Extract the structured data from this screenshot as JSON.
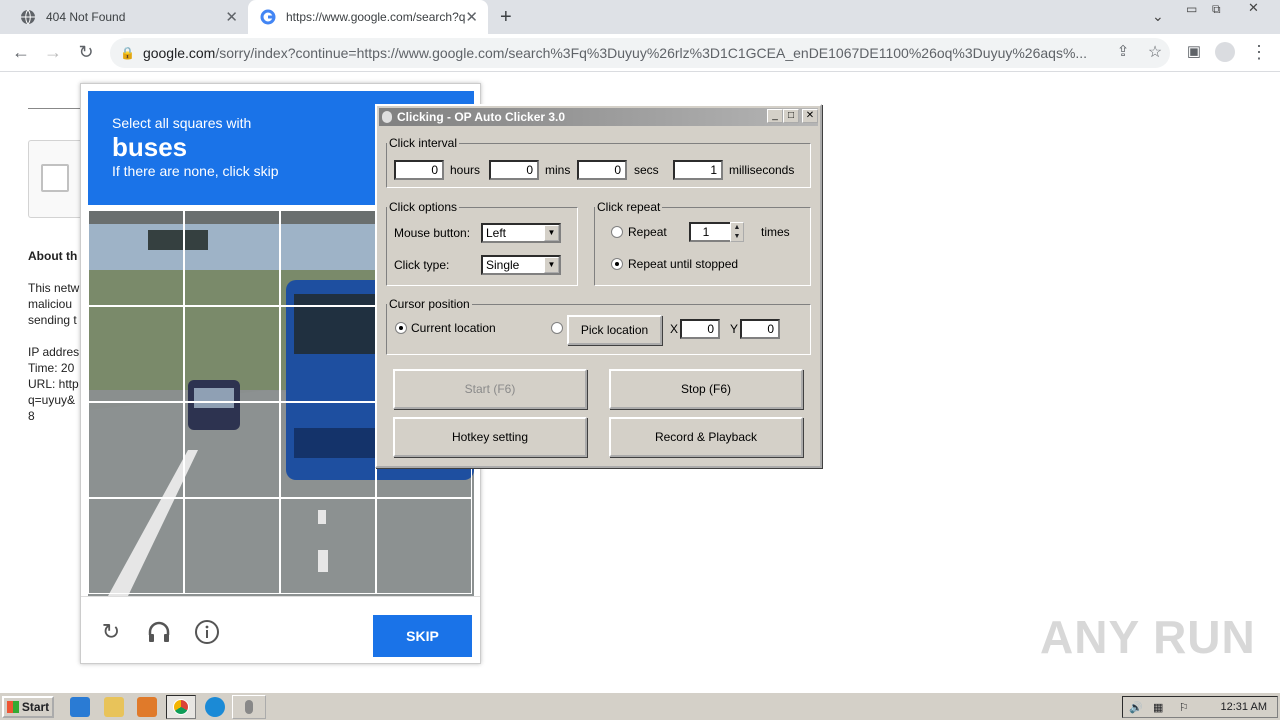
{
  "browser": {
    "tabs": [
      {
        "title": "404 Not Found",
        "icon": "globe-icon"
      },
      {
        "title": "https://www.google.com/search?q=",
        "icon": "google-icon"
      }
    ],
    "new_tab_label": "+",
    "address_domain": "google.com",
    "address_rest": "/sorry/index?continue=https://www.google.com/search%3Fq%3Duyuy%26rlz%3D1C1GCEA_enDE1067DE1100%26oq%3Duyuy%26aqs%..."
  },
  "page": {
    "about_heading": "About th",
    "body_lines": [
      "This netw",
      "maliciou",
      "sending t"
    ],
    "info_lines": [
      "IP addres",
      "Time: 20",
      "URL: http",
      "q=uyuy&",
      "8"
    ]
  },
  "recaptcha": {
    "instruction_line1": "Select all squares with",
    "target_word": "buses",
    "instruction_line3": "If there are none, click skip",
    "skip_label": "SKIP"
  },
  "clicker": {
    "title": "Clicking - OP Auto Clicker 3.0",
    "interval_label": "Click interval",
    "hours": "0",
    "hours_label": "hours",
    "mins": "0",
    "mins_label": "mins",
    "secs": "0",
    "secs_label": "secs",
    "ms": "1",
    "ms_label": "milliseconds",
    "options_label": "Click options",
    "mouse_button_label": "Mouse button:",
    "mouse_button_value": "Left",
    "click_type_label": "Click type:",
    "click_type_value": "Single",
    "repeat_group_label": "Click repeat",
    "repeat_label": "Repeat",
    "repeat_value": "1",
    "times_label": "times",
    "repeat_until_label": "Repeat until stopped",
    "cursor_label": "Cursor position",
    "current_location_label": "Current location",
    "pick_location_label": "Pick location",
    "x_label": "X",
    "x_value": "0",
    "y_label": "Y",
    "y_value": "0",
    "start_label": "Start (F6)",
    "stop_label": "Stop (F6)",
    "hotkey_label": "Hotkey setting",
    "record_label": "Record & Playback"
  },
  "watermark": "ANY RUN",
  "taskbar": {
    "start_label": "Start",
    "clock": "12:31 AM"
  }
}
